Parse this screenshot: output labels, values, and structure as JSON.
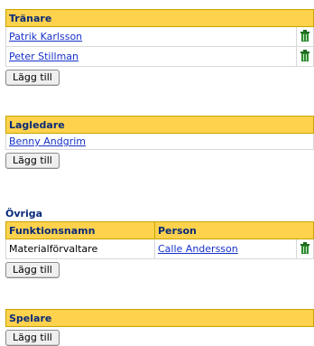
{
  "coaches": {
    "header": "Tränare",
    "rows": [
      {
        "name": "Patrik Karlsson",
        "icon": "trash-icon"
      },
      {
        "name": "Peter Stillman",
        "icon": "trash-icon"
      }
    ],
    "add_label": "Lägg till"
  },
  "leaders": {
    "header": "Lagledare",
    "rows": [
      {
        "name": "Benny Andgrim"
      }
    ],
    "add_label": "Lägg till"
  },
  "others": {
    "title": "Övriga",
    "columns": [
      "Funktionsnamn",
      "Person"
    ],
    "rows": [
      {
        "function": "Materialförvaltare",
        "person": "Calle Andersson",
        "icon": "trash-icon"
      }
    ],
    "add_label": "Lägg till"
  },
  "players": {
    "header": "Spelare",
    "add_label": "Lägg till"
  },
  "colors": {
    "header_bg": "#ffd24d",
    "header_text": "#0a2a78",
    "link": "#1530c8",
    "trash_icon": "#1f6b1f"
  }
}
